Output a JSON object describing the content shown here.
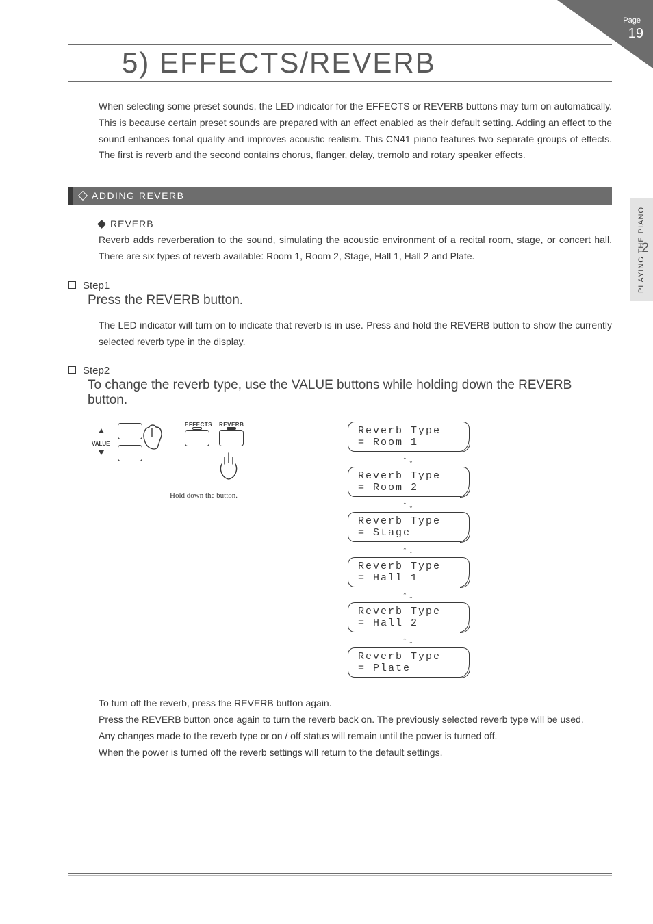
{
  "corner": {
    "page_word": "Page",
    "page_num": "19"
  },
  "sidetab": {
    "text": "PLAYING THE PIANO",
    "num": "2"
  },
  "title": "5) EFFECTS/REVERB",
  "intro": "When selecting some preset sounds, the LED indicator for the EFFECTS or REVERB buttons may turn on automatically. This is because certain preset sounds are prepared with an effect enabled as their default setting. Adding an effect to the sound enhances tonal quality and improves acoustic realism. This CN41 piano features two separate groups of effects. The first is reverb and the second contains chorus, flanger, delay, tremolo and rotary speaker effects.",
  "section1": {
    "title": "ADDING REVERB"
  },
  "reverb": {
    "head": "REVERB",
    "body": "Reverb adds reverberation to the sound, simulating the acoustic environment of a recital room, stage, or concert hall. There are six types of reverb available: Room 1, Room 2, Stage, Hall 1, Hall 2 and Plate."
  },
  "step1": {
    "label": "Step1",
    "action": "Press the REVERB button.",
    "desc": "The LED indicator will turn on to indicate that reverb is in use. Press and hold the REVERB button to show the currently selected reverb type in the display."
  },
  "step2": {
    "label": "Step2",
    "action": "To change the reverb type, use the VALUE buttons while holding down the REVERB button."
  },
  "controls": {
    "value": "VALUE",
    "effects": "EFFECTS",
    "reverb": "REVERB",
    "hold": "Hold down the button."
  },
  "lcds": [
    {
      "l1": "Reverb Type",
      "l2": " = Room 1"
    },
    {
      "l1": "Reverb Type",
      "l2": " = Room 2"
    },
    {
      "l1": "Reverb Type",
      "l2": " = Stage"
    },
    {
      "l1": "Reverb Type",
      "l2": " = Hall 1"
    },
    {
      "l1": "Reverb Type",
      "l2": " = Hall 2"
    },
    {
      "l1": "Reverb Type",
      "l2": " = Plate"
    }
  ],
  "arrows": "↑↓",
  "closing": [
    "To turn off the reverb, press the REVERB button again.",
    "Press the REVERB button once again to turn the reverb back on. The previously selected reverb type will be used.",
    "Any changes made to the reverb type or on / off status will remain until the power is turned off.",
    "When the power is turned off the reverb settings will return to the default settings."
  ]
}
